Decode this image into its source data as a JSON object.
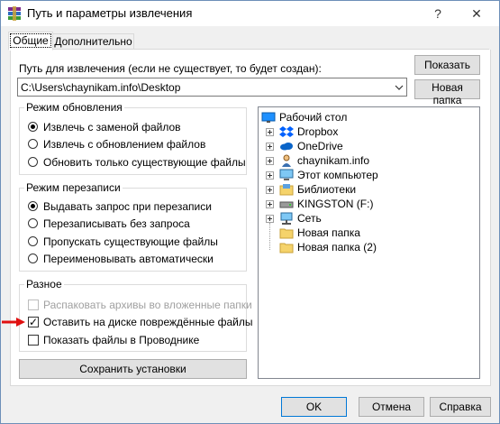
{
  "window": {
    "title": "Путь и параметры извлечения",
    "help_glyph": "?",
    "close_glyph": "✕"
  },
  "tabs": [
    {
      "label": "Общие",
      "active": true
    },
    {
      "label": "Дополнительно",
      "active": false
    }
  ],
  "path": {
    "label": "Путь для извлечения (если не существует, то будет создан):",
    "value": "C:\\Users\\chaynikam.info\\Desktop",
    "show_button": "Показать",
    "new_folder_button": "Новая папка"
  },
  "update_mode": {
    "title": "Режим обновления",
    "options": [
      {
        "label": "Извлечь с заменой файлов",
        "selected": true
      },
      {
        "label": "Извлечь с обновлением файлов",
        "selected": false
      },
      {
        "label": "Обновить только существующие файлы",
        "selected": false
      }
    ]
  },
  "overwrite_mode": {
    "title": "Режим перезаписи",
    "options": [
      {
        "label": "Выдавать запрос при перезаписи",
        "selected": true
      },
      {
        "label": "Перезаписывать без запроса",
        "selected": false
      },
      {
        "label": "Пропускать существующие файлы",
        "selected": false
      },
      {
        "label": "Переименовывать автоматически",
        "selected": false
      }
    ]
  },
  "misc": {
    "title": "Разное",
    "options": [
      {
        "label": "Распаковать архивы во вложенные папки",
        "checked": false,
        "disabled": true
      },
      {
        "label": "Оставить на диске повреждённые файлы",
        "checked": true,
        "disabled": false
      },
      {
        "label": "Показать файлы в Проводнике",
        "checked": false,
        "disabled": false
      }
    ]
  },
  "save_settings_button": "Сохранить установки",
  "tree": {
    "root": "Рабочий стол",
    "items": [
      {
        "label": "Dropbox",
        "icon": "dropbox-icon",
        "expandable": true
      },
      {
        "label": "OneDrive",
        "icon": "onedrive-cloud-icon",
        "expandable": true
      },
      {
        "label": "chaynikam.info",
        "icon": "user-icon",
        "expandable": true
      },
      {
        "label": "Этот компьютер",
        "icon": "computer-icon",
        "expandable": true
      },
      {
        "label": "Библиотеки",
        "icon": "libraries-icon",
        "expandable": true
      },
      {
        "label": "KINGSTON (F:)",
        "icon": "usb-drive-icon",
        "expandable": true
      },
      {
        "label": "Сеть",
        "icon": "network-icon",
        "expandable": true
      },
      {
        "label": "Новая папка",
        "icon": "folder-icon",
        "expandable": false
      },
      {
        "label": "Новая папка (2)",
        "icon": "folder-icon",
        "expandable": false
      }
    ]
  },
  "footer": {
    "ok": "OK",
    "cancel": "Отмена",
    "help": "Справка"
  },
  "colors": {
    "accent": "#0078d7",
    "annotation_arrow": "#e01010",
    "folder": "#f5d36b",
    "dropbox": "#0061fe"
  }
}
